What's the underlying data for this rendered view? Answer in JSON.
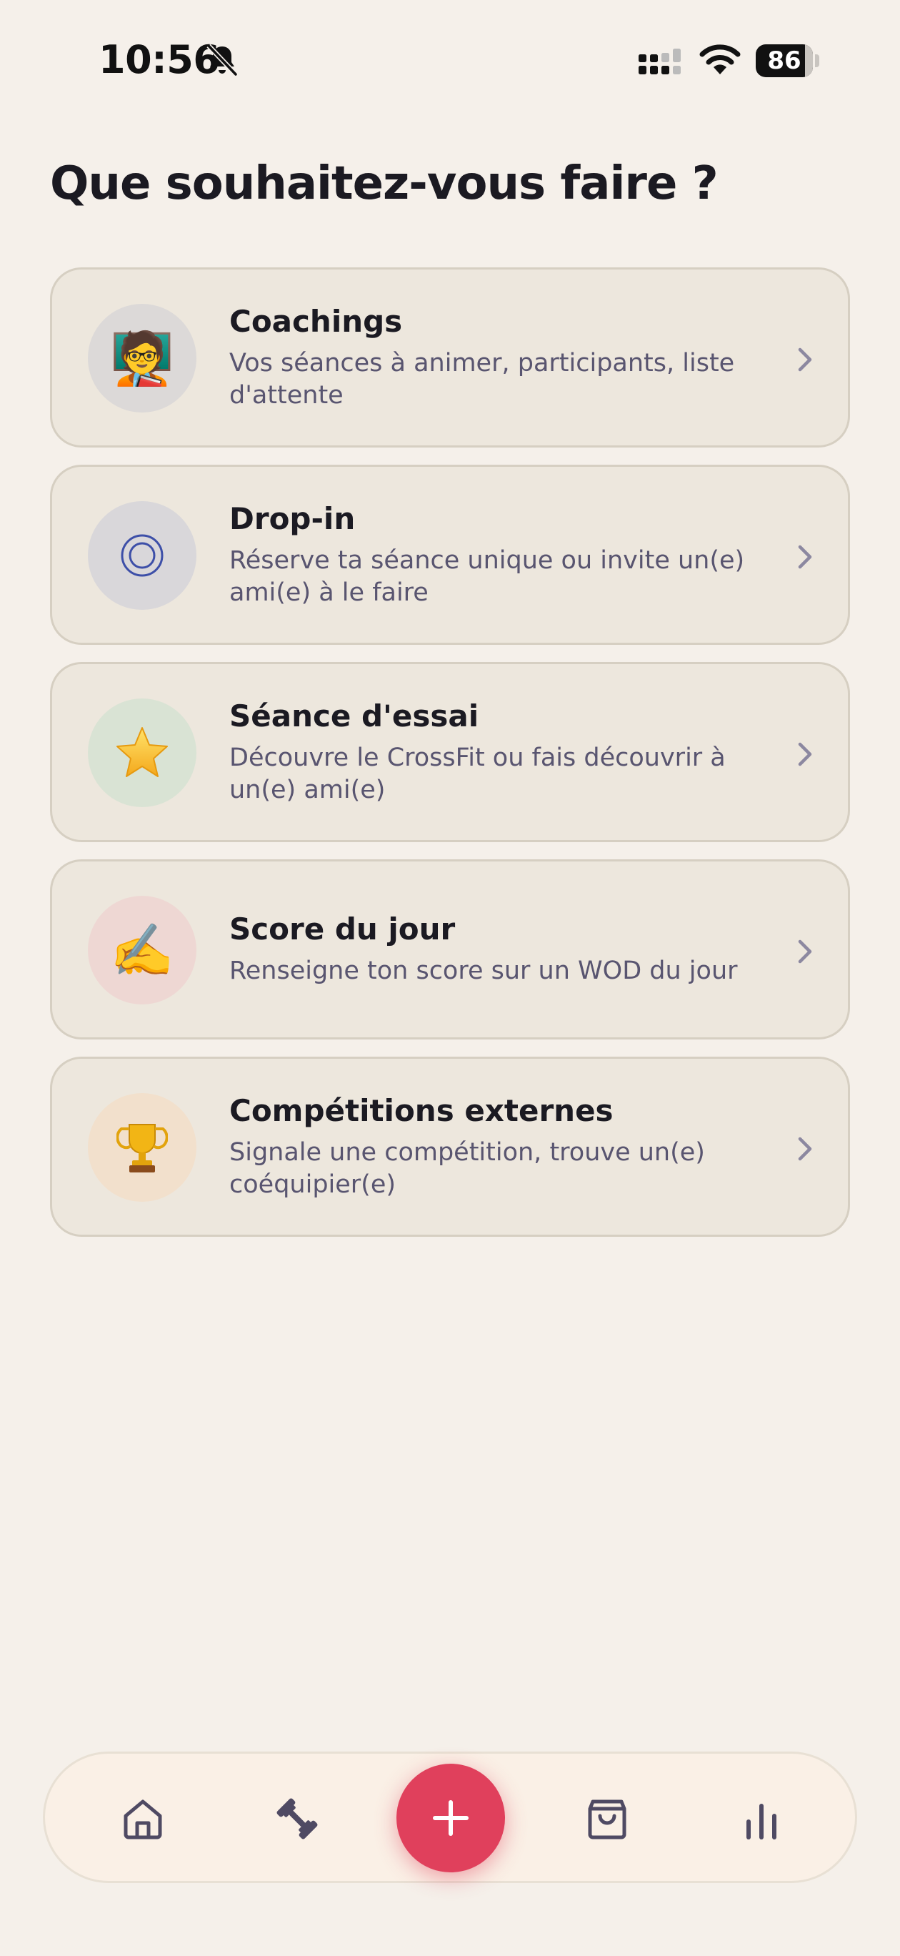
{
  "status_bar": {
    "time": "10:56",
    "battery": "86",
    "battery_level": 0.86
  },
  "page": {
    "title": "Que souhaitez-vous faire ?"
  },
  "cards": [
    {
      "icon": "teacher-emoji-icon",
      "glyph": "🧑‍🏫",
      "icon_bg": "#dcd9d8",
      "title": "Coachings",
      "description": "Vos séances à animer, participants, liste d'attente"
    },
    {
      "icon": "target-circle-icon",
      "glyph": "◎",
      "icon_bg": "#d9d7da",
      "title": "Drop-in",
      "description": "Réserve ta séance unique ou invite un(e) ami(e) à le faire"
    },
    {
      "icon": "star-emoji-icon",
      "glyph": "⭐",
      "icon_bg": "#d9e3d4",
      "title": "Séance d'essai",
      "description": "Découvre le CrossFit ou fais découvrir à un(e) ami(e)"
    },
    {
      "icon": "writing-hand-emoji-icon",
      "glyph": "✍️",
      "icon_bg": "#eed7d3",
      "title": "Score du jour",
      "description": "Renseigne ton score sur un WOD du jour"
    },
    {
      "icon": "trophy-emoji-icon",
      "glyph": "🏆",
      "icon_bg": "#f2e0cc",
      "title": "Compétitions externes",
      "description": "Signale une compétition, trouve un(e) coéquipier(e)"
    }
  ],
  "bottom_nav": {
    "items": [
      "home-icon",
      "dumbbell-icon",
      "plus-icon",
      "shopping-bag-icon",
      "bar-chart-icon"
    ],
    "accent": "#e0405c",
    "icon_color": "#4f4a63"
  }
}
